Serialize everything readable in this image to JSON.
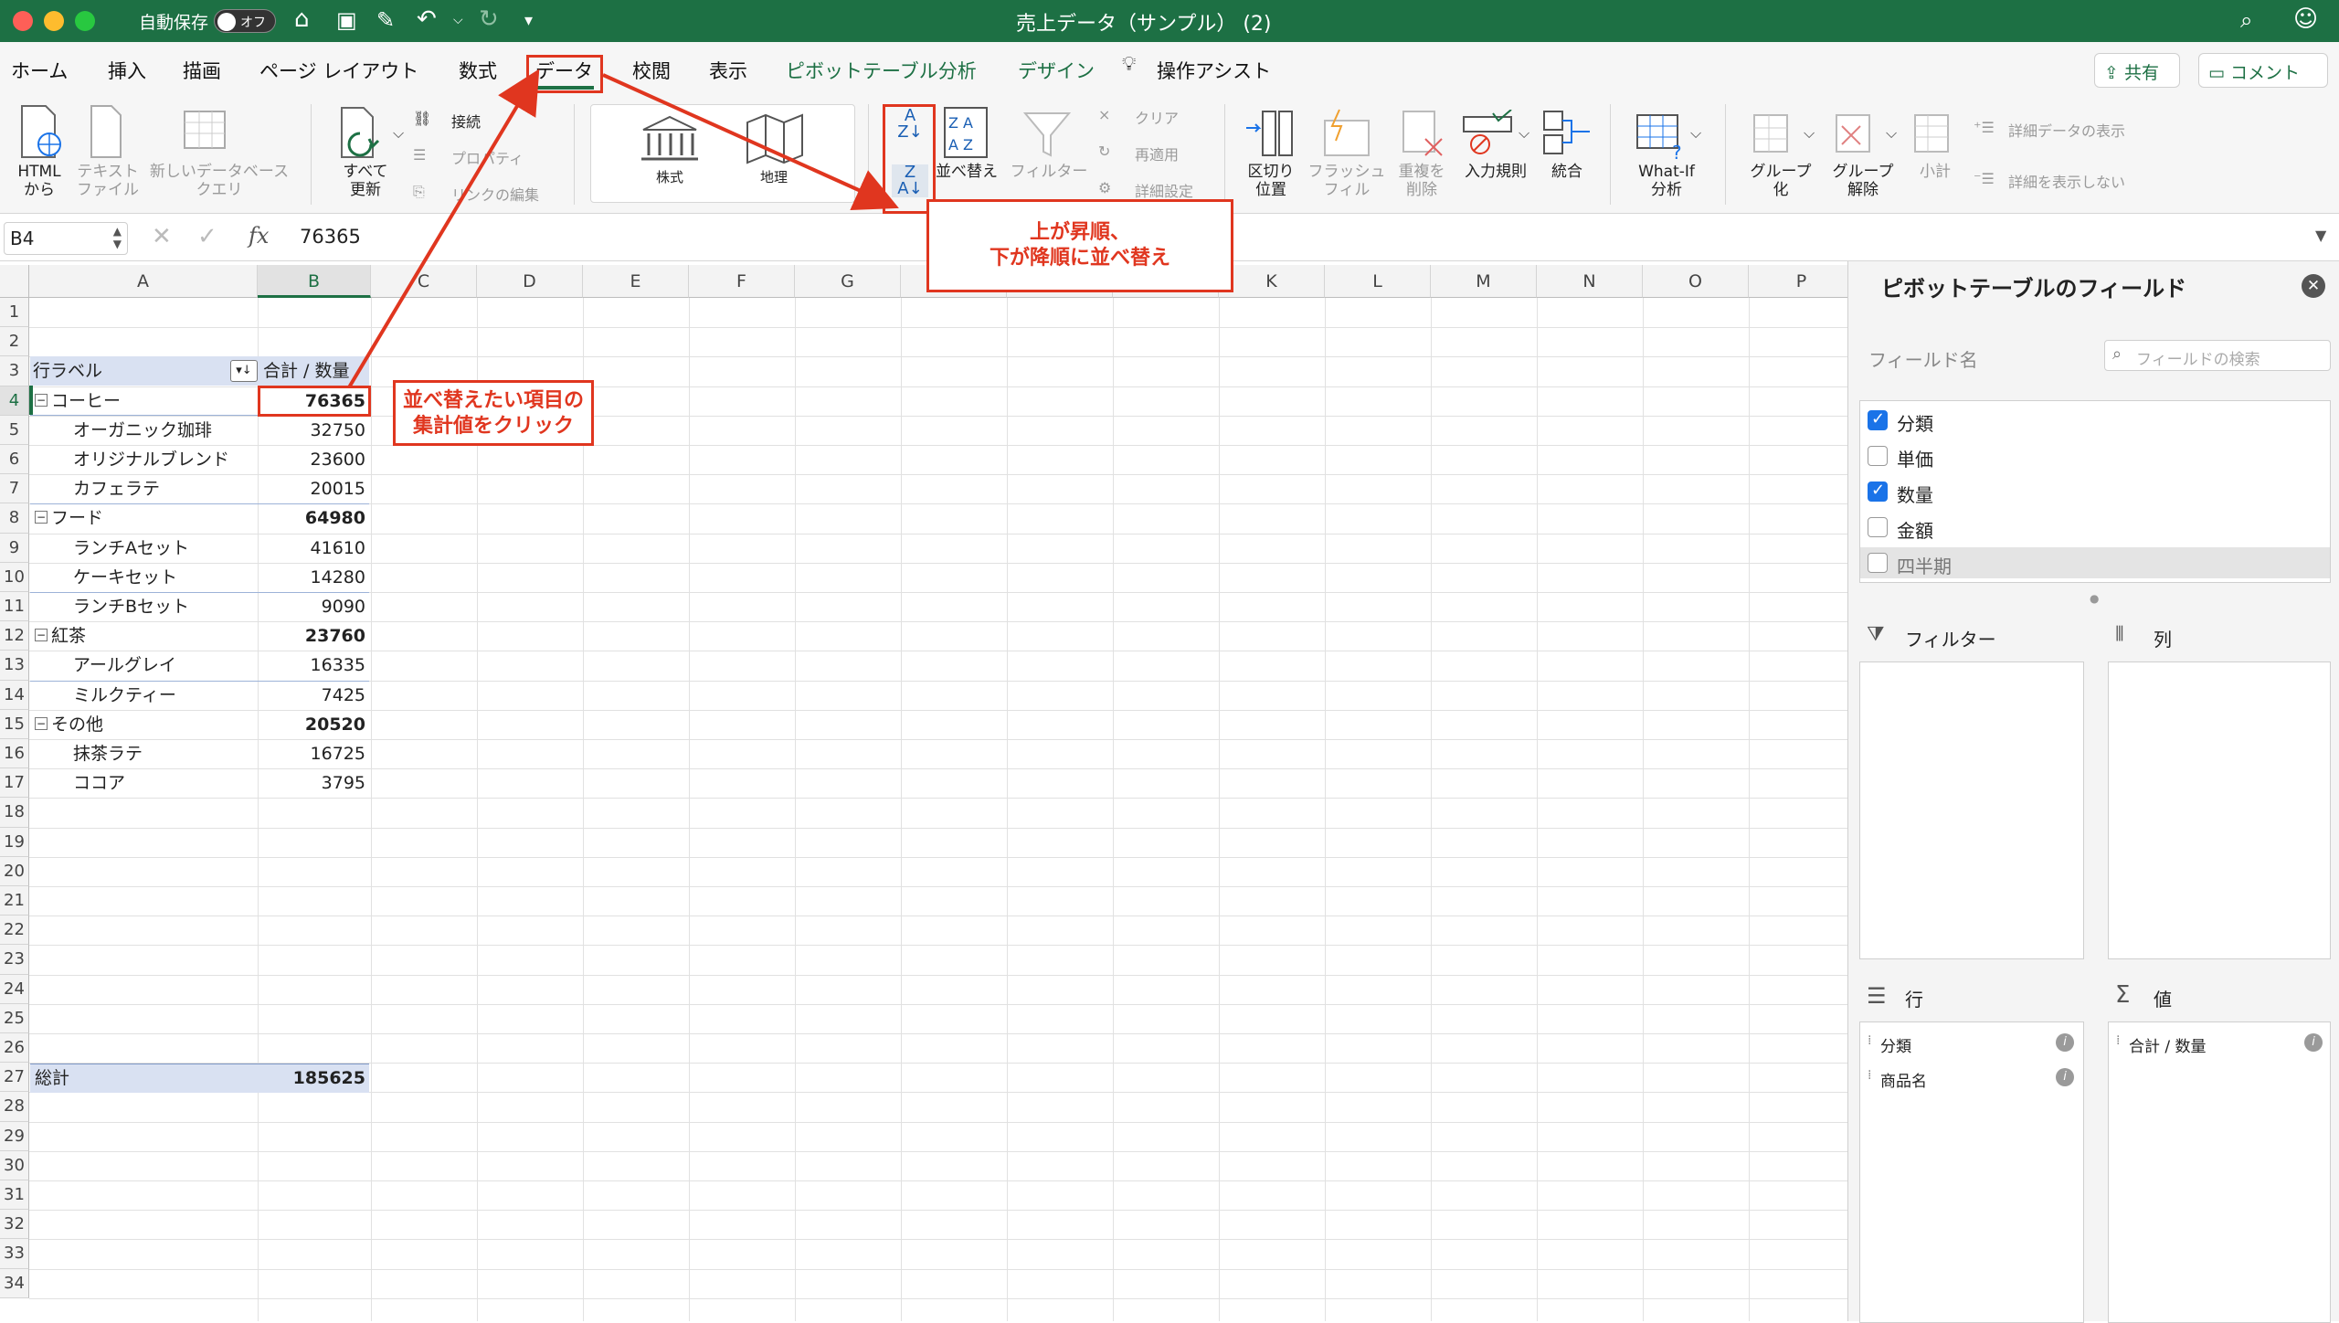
{
  "titlebar": {
    "autosave_label": "自動保存",
    "autosave_state": "オフ",
    "doc_title": "売上データ（サンプル） (2)"
  },
  "tabs": [
    "ホーム",
    "挿入",
    "描画",
    "ページ レイアウト",
    "数式",
    "データ",
    "校閲",
    "表示",
    "ピボットテーブル分析",
    "デザイン",
    "操作アシスト"
  ],
  "share_label": "共有",
  "comment_label": "コメント",
  "ribbon": {
    "html": "HTML\nから",
    "text_file": "テキスト\nファイル",
    "new_db_query": "新しいデータベース\nクエリ",
    "refresh_all": "すべて\n更新",
    "connections": "接続",
    "properties": "プロパティ",
    "edit_links": "リンクの編集",
    "stocks": "株式",
    "geography": "地理",
    "sort": "並べ替え",
    "filter": "フィルター",
    "clear": "クリア",
    "reapply": "再適用",
    "advanced": "詳細設定",
    "text_to_columns": "区切り\n位置",
    "flash_fill": "フラッシュ\nフィル",
    "remove_dup": "重複を\n削除",
    "validation": "入力規則",
    "consolidate": "統合",
    "whatif": "What-If\n分析",
    "group": "グループ\n化",
    "ungroup": "グループ\n解除",
    "subtotal": "小計",
    "show_detail": "詳細データの表示",
    "hide_detail": "詳細を表示しない"
  },
  "formula_bar": {
    "name_box": "B4",
    "value": "76365"
  },
  "columns": [
    "A",
    "B",
    "C",
    "D",
    "E",
    "F",
    "G",
    "H",
    "I",
    "J",
    "K",
    "L",
    "M",
    "N",
    "O",
    "P"
  ],
  "rows": [
    "1",
    "2",
    "3",
    "4",
    "5",
    "6",
    "7",
    "8",
    "9",
    "10",
    "11",
    "12",
    "13",
    "14",
    "15",
    "16",
    "17",
    "18",
    "19",
    "20",
    "21",
    "22",
    "23",
    "24",
    "25",
    "26",
    "27",
    "28",
    "29",
    "30",
    "31",
    "32",
    "33",
    "34"
  ],
  "pivot": {
    "row_label_header": "行ラベル",
    "value_header": "合計 / 数量",
    "rows": [
      {
        "label": "コーヒー",
        "value": "76365",
        "level": 0
      },
      {
        "label": "オーガニック珈琲",
        "value": "32750",
        "level": 1
      },
      {
        "label": "オリジナルブレンド",
        "value": "23600",
        "level": 1
      },
      {
        "label": "カフェラテ",
        "value": "20015",
        "level": 1
      },
      {
        "label": "フード",
        "value": "64980",
        "level": 0
      },
      {
        "label": "ランチAセット",
        "value": "41610",
        "level": 1
      },
      {
        "label": "ケーキセット",
        "value": "14280",
        "level": 1
      },
      {
        "label": "ランチBセット",
        "value": "9090",
        "level": 1
      },
      {
        "label": "紅茶",
        "value": "23760",
        "level": 0
      },
      {
        "label": "アールグレイ",
        "value": "16335",
        "level": 1
      },
      {
        "label": "ミルクティー",
        "value": "7425",
        "level": 1
      },
      {
        "label": "その他",
        "value": "20520",
        "level": 0
      },
      {
        "label": "抹茶ラテ",
        "value": "16725",
        "level": 1
      },
      {
        "label": "ココア",
        "value": "3795",
        "level": 1
      }
    ],
    "grand_total_label": "総計",
    "grand_total_value": "185625"
  },
  "pane": {
    "title": "ピボットテーブルのフィールド",
    "field_name_label": "フィールド名",
    "search_placeholder": "フィールドの検索",
    "fields": [
      {
        "name": "分類",
        "checked": true
      },
      {
        "name": "単価",
        "checked": false
      },
      {
        "name": "数量",
        "checked": true
      },
      {
        "name": "金額",
        "checked": false
      },
      {
        "name": "四半期",
        "checked": false
      }
    ],
    "filter_label": "フィルター",
    "columns_label": "列",
    "rows_label": "行",
    "values_label": "値",
    "row_items": [
      "分類",
      "商品名"
    ],
    "value_items": [
      "合計 / 数量"
    ]
  },
  "annotations": {
    "sort_note": "上が昇順、\n下が降順に並べ替え",
    "click_note": "並べ替えたい項目の\n集計値をクリック"
  },
  "colors": {
    "excel_green": "#1d7044",
    "annotation_red": "#e0361f",
    "pivot_header": "#d9e1f2"
  }
}
